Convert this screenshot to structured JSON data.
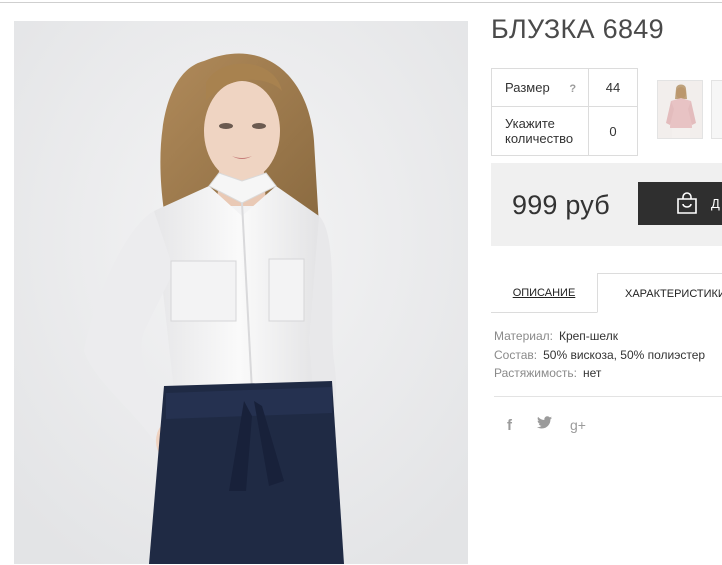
{
  "product": {
    "title": "БЛУЗКА 6849",
    "image_alt": "Блузка 6849"
  },
  "options": {
    "size_label": "Размер",
    "size_help": "?",
    "size_value": "44",
    "quantity_label_line1": "Укажите",
    "quantity_label_line2": "количество",
    "quantity_value": "0"
  },
  "price": {
    "amount": "999 руб",
    "cart_button": "Д"
  },
  "tabs": [
    {
      "label": "ОПИСАНИЕ",
      "active": false
    },
    {
      "label": "ХАРАКТЕРИСТИКИ",
      "active": true
    }
  ],
  "specs": [
    {
      "label": "Материал:",
      "value": "Креп-шелк"
    },
    {
      "label": "Состав:",
      "value": "50% вискоза, 50% полиэстер"
    },
    {
      "label": "Растяжимость:",
      "value": "нет"
    }
  ],
  "social": {
    "facebook": "f",
    "twitter": "🐦",
    "googleplus": "g+"
  },
  "colors": {
    "button_dark": "#2f2f2f",
    "price_bg": "#f0f0f0"
  }
}
